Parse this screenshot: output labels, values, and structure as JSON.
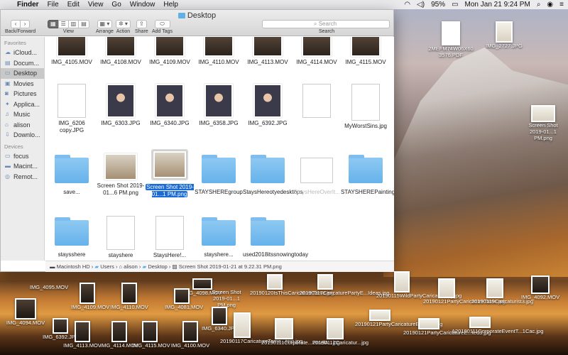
{
  "menubar": {
    "items": [
      "Finder",
      "File",
      "Edit",
      "View",
      "Go",
      "Window",
      "Help"
    ],
    "battery": "95%",
    "datetime": "Mon Jan 21  9:24 PM"
  },
  "window": {
    "title": "Desktop",
    "toolbar": {
      "back_forward": "Back/Forward",
      "view": "View",
      "arrange": "Arrange",
      "action": "Action",
      "share": "Share",
      "add_tags": "Add Tags",
      "search_placeholder": "Search",
      "search_label": "Search"
    },
    "sidebar": {
      "favorites_header": "Favorites",
      "favorites": [
        "iCloud...",
        "Docum...",
        "Desktop",
        "Movies",
        "Pictures",
        "Applica...",
        "Music",
        "alison",
        "Downlo..."
      ],
      "devices_header": "Devices",
      "devices": [
        "focus",
        "Macint...",
        "Remot..."
      ]
    },
    "rows": [
      [
        "IMG_4105.MOV",
        "IMG_4108.MOV",
        "IMG_4109.MOV",
        "IMG_4110.MOV",
        "IMG_4113.MOV",
        "IMG_4114.MOV",
        "IMG_4115.MOV"
      ],
      [
        "IMG_6206 copy.JPG",
        "IMG_6303.JPG",
        "IMG_6340.JPG",
        "IMG_6358.JPG",
        "IMG_6392.JPG",
        "",
        "MyWorstSins.jpg"
      ],
      [
        "save...",
        "Screen Shot 2019-01...6 PM.png",
        "Screen Shot 2019-01...1 PM.png",
        "STAYSHEREgroup",
        "StaysHereotyedesktops",
        "StaysHereOverIt...",
        "STAYSHEREPaintingsForSale"
      ],
      [
        "staysshere",
        "stayshere",
        "StaysHere!...",
        "stayshere...",
        "used2018itssnowingtoday"
      ]
    ],
    "path": [
      "Macintosh HD",
      "Users",
      "alison",
      "Desktop",
      "Screen Shot 2019-01-21 at 9.22.31 PM.png"
    ]
  },
  "desktop_icons": [
    {
      "label": "2MEFM74W06X60 3576.PDF"
    },
    {
      "label": "IMG_2727.JPG"
    },
    {
      "label": "Screen Shot 2019-01...1 PM.png"
    },
    {
      "label": "IMG_4095.MOV"
    },
    {
      "label": "IMG_4098.MOV"
    },
    {
      "label": "Screen Shot 2019-01...1 PM.png"
    },
    {
      "label": "20190120IsThisCaricatureTame.jpg"
    },
    {
      "label": "20190117CaricaturePartyE...Ideas.jpg"
    },
    {
      "label": "20190115WildPartyCarica...copy.jpg"
    },
    {
      "label": "20190121PartyCaricatureTame.jpg"
    },
    {
      "label": "20190119Caricaturist3.jpg"
    },
    {
      "label": "IMG_4092.MOV"
    },
    {
      "label": "IMG_4109.MOV"
    },
    {
      "label": "IMG_4110.MOV"
    },
    {
      "label": "IMG_4081.MOV"
    },
    {
      "label": "IMG_4094.MOV"
    },
    {
      "label": "IMG_6340.JPG"
    },
    {
      "label": "IMG_6392.JPG"
    },
    {
      "label": "IMG_4113.MOV"
    },
    {
      "label": "IMG_4114.MOV"
    },
    {
      "label": "IMG_4115.MOV"
    },
    {
      "label": "IMG_4100.MOV"
    },
    {
      "label": "20190117CaricatureTame...ting.jpg"
    },
    {
      "label": "20190111Corporate...ErnelA...jpg"
    },
    {
      "label": "20190117Caricatur...jpg"
    },
    {
      "label": "20190121PartyCaricatureE...ted5.jpg"
    },
    {
      "label": "A20190111CorporateEventT...1Cac.jpg"
    },
    {
      "label": "20190121PartyCaricatureE...ted3.jpg"
    }
  ]
}
